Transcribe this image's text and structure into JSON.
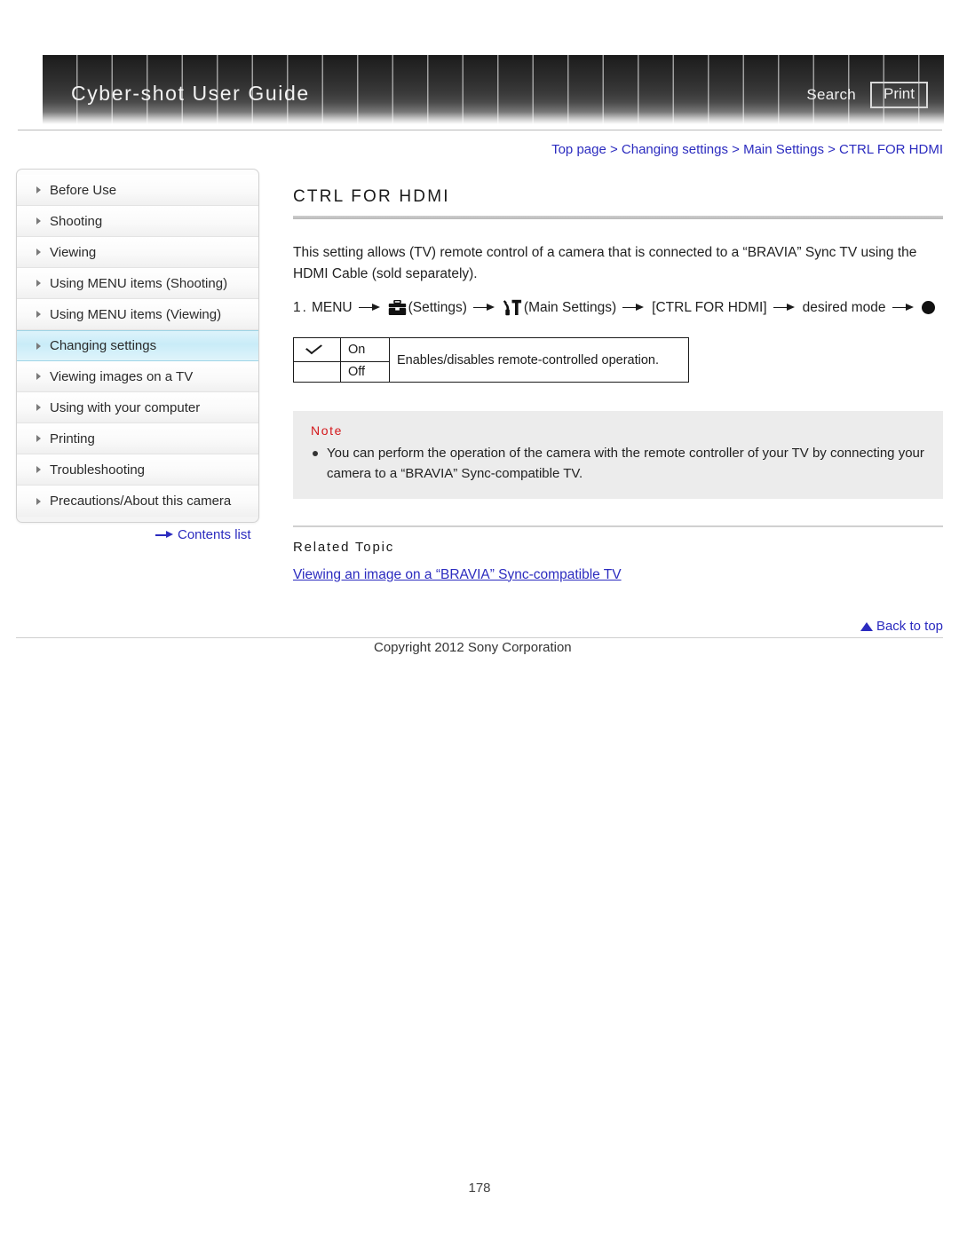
{
  "header": {
    "title": "Cyber-shot User Guide",
    "search_label": "Search",
    "print_label": "Print"
  },
  "sidebar": {
    "items": [
      {
        "label": "Before Use",
        "active": false
      },
      {
        "label": "Shooting",
        "active": false
      },
      {
        "label": "Viewing",
        "active": false
      },
      {
        "label": "Using MENU items (Shooting)",
        "active": false
      },
      {
        "label": "Using MENU items (Viewing)",
        "active": false
      },
      {
        "label": "Changing settings",
        "active": true
      },
      {
        "label": "Viewing images on a TV",
        "active": false
      },
      {
        "label": "Using with your computer",
        "active": false
      },
      {
        "label": "Printing",
        "active": false
      },
      {
        "label": "Troubleshooting",
        "active": false
      },
      {
        "label": "Precautions/About this camera",
        "active": false
      }
    ],
    "contents_list_label": "Contents list"
  },
  "main": {
    "breadcrumb": "Top page > Changing settings > Main Settings > CTRL FOR HDMI",
    "title": "CTRL FOR HDMI",
    "intro": "This setting allows (TV) remote control of a camera that is connected to a “BRAVIA” Sync TV using the HDMI Cable (sold separately).",
    "step": {
      "number": "1.",
      "menu_label": "MENU",
      "settings_label": "(Settings)",
      "main_settings_label": "(Main Settings)",
      "item_label": "[CTRL FOR HDMI]",
      "desired_mode_label": "desired mode",
      "settings_icon": "toolbox-icon",
      "main_settings_icon": "wrench-tool-icon",
      "end_icon": "filled-circle-icon"
    },
    "options": {
      "rows": [
        {
          "checked": "✓",
          "mode": "On"
        },
        {
          "checked": "",
          "mode": "Off"
        }
      ],
      "description": "Enables/disables remote-controlled operation."
    },
    "note": {
      "title": "Note",
      "items": [
        "You can perform the operation of the camera with the remote controller of your TV by connecting your camera to a “BRAVIA” Sync-compatible TV."
      ]
    },
    "related": {
      "heading": "Related Topic",
      "links": [
        "Viewing an image on a “BRAVIA” Sync-compatible TV"
      ]
    },
    "back_to_top_label": "Back to top"
  },
  "footer": {
    "copyright": "Copyright 2012 Sony Corporation",
    "page_number": "178"
  },
  "colors": {
    "link": "#2b2bbf",
    "note_title": "#d4181c",
    "active_nav": "#c9ecf8"
  }
}
